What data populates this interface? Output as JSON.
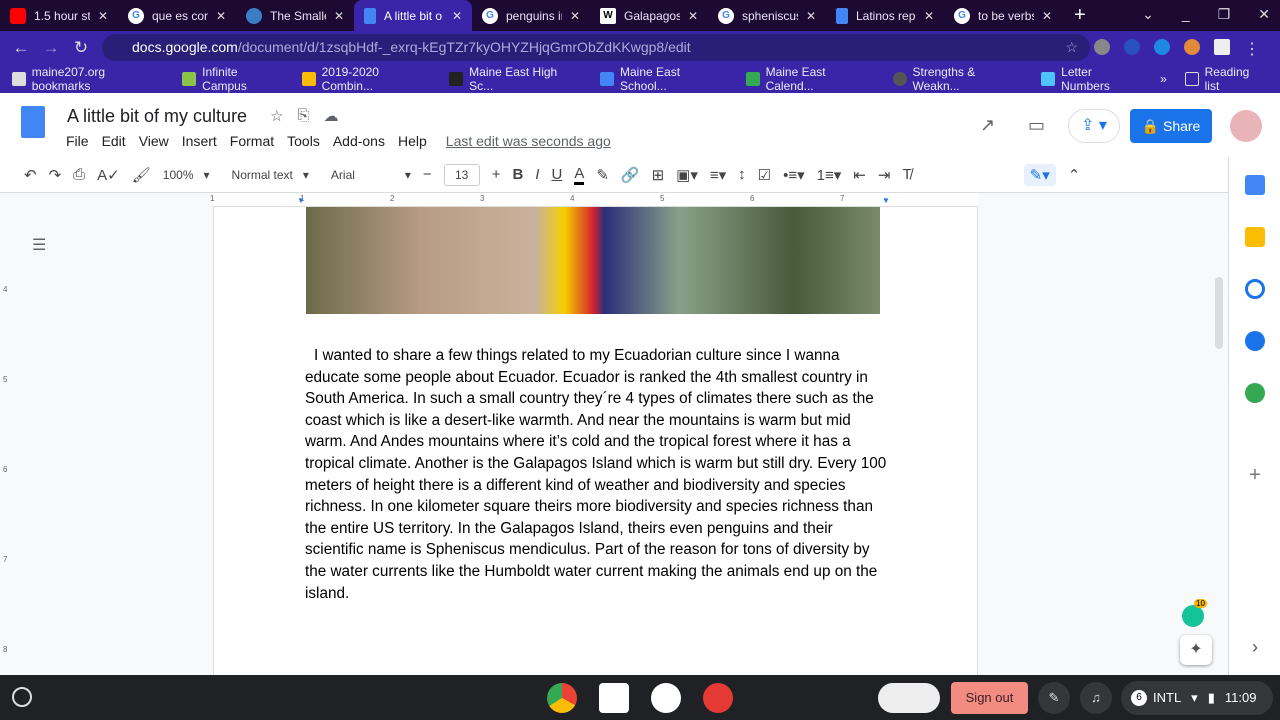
{
  "browser": {
    "tabs": [
      {
        "label": "1.5 hour stu",
        "icon": "youtube-icon"
      },
      {
        "label": "que es corr",
        "icon": "google-icon"
      },
      {
        "label": "The Smalles",
        "icon": "globe-icon"
      },
      {
        "label": "A little bit o",
        "icon": "docs-icon",
        "active": true
      },
      {
        "label": "penguins in",
        "icon": "google-icon"
      },
      {
        "label": "Galapagos",
        "icon": "wikipedia-icon"
      },
      {
        "label": "spheniscus",
        "icon": "google-icon"
      },
      {
        "label": "Latinos rep",
        "icon": "docs-icon"
      },
      {
        "label": "to be verbs",
        "icon": "google-icon"
      }
    ],
    "url_host": "docs.google.com",
    "url_path": "/document/d/1zsqbHdf-_exrq-kEgTZr7kyOHYZHjqGmrObZdKKwgp8/edit",
    "bookmarks": [
      "maine207.org bookmarks",
      "Infinite Campus",
      "2019-2020 Combin...",
      "Maine East High Sc...",
      "Maine East School...",
      "Maine East Calend...",
      "Strengths & Weakn...",
      "Letter Numbers"
    ],
    "reading_list": "Reading list"
  },
  "doc": {
    "title": "A little bit of my culture",
    "menu": [
      "File",
      "Edit",
      "View",
      "Insert",
      "Format",
      "Tools",
      "Add-ons",
      "Help"
    ],
    "last_edit": "Last edit was seconds ago",
    "share": "Share",
    "toolbar": {
      "zoom": "100%",
      "style": "Normal text",
      "font": "Arial",
      "size": "13"
    },
    "ruler": [
      "1",
      "2",
      "3",
      "4",
      "5",
      "6",
      "7"
    ],
    "margin_numbers": [
      "4",
      "5",
      "6",
      "7",
      "8"
    ],
    "body": "I wanted to share a few things related to my Ecuadorian culture since I wanna educate some people about Ecuador. Ecuador is ranked the 4th smallest country in South America. In such a small country they´re 4 types of climates there such as the coast which is like a desert-like warmth. And near the mountains is warm but mid warm. And Andes mountains where it’s cold and the tropical forest where it has a tropical climate. Another is the Galapagos Island which is warm but still dry. Every 100 meters of height there is a different kind of weather and biodiversity and species richness. In one kilometer square theirs more biodiversity and species richness than the entire US territory. In the Galapagos Island, theirs even penguins and their scientific name is Spheniscus mendiculus. Part of the reason for tons of diversity by the water currents like the Humboldt water current making the animals end up on the island.",
    "grammarly_count": "10"
  },
  "shelf": {
    "sign_out": "Sign out",
    "notif": "6",
    "ime": "INTL",
    "time": "11:09"
  }
}
